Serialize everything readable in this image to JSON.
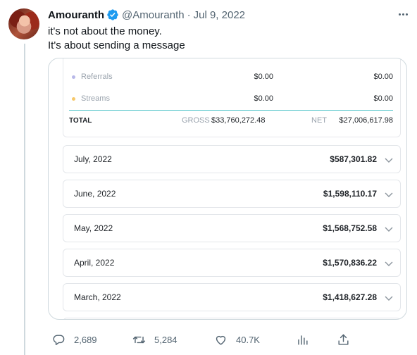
{
  "tweet": {
    "author_name": "Amouranth",
    "handle": "@Amouranth",
    "separator": "·",
    "date": "Jul 9, 2022",
    "text_line1": "it's not about the money.",
    "text_line2": "It's about sending a message"
  },
  "summary": {
    "rows": [
      {
        "label": "Referrals",
        "gross": "$0.00",
        "net": "$0.00",
        "color": "#b8b8e8"
      },
      {
        "label": "Streams",
        "gross": "$0.00",
        "net": "$0.00",
        "color": "#f6c86a"
      }
    ],
    "total_label": "TOTAL",
    "gross_label": "GROSS",
    "gross_value": "$33,760,272.48",
    "net_label": "NET",
    "net_value": "$27,006,617.98"
  },
  "months": [
    {
      "month": "July, 2022",
      "amount": "$587,301.82"
    },
    {
      "month": "June, 2022",
      "amount": "$1,598,110.17"
    },
    {
      "month": "May, 2022",
      "amount": "$1,568,752.58"
    },
    {
      "month": "April, 2022",
      "amount": "$1,570,836.22"
    },
    {
      "month": "March, 2022",
      "amount": "$1,418,627.28"
    }
  ],
  "actions": {
    "replies": "2,689",
    "retweets": "5,284",
    "likes": "40.7K"
  },
  "icons": {
    "verified": "verified-badge-icon",
    "more": "more-options-icon",
    "reply": "reply-icon",
    "retweet": "retweet-icon",
    "like": "heart-icon",
    "analytics": "analytics-icon",
    "share": "share-icon",
    "expand": "chevron-down-icon"
  },
  "colors": {
    "verified": "#1d9bf0",
    "accent_divider": "#4fc4c8",
    "muted": "#536471"
  }
}
